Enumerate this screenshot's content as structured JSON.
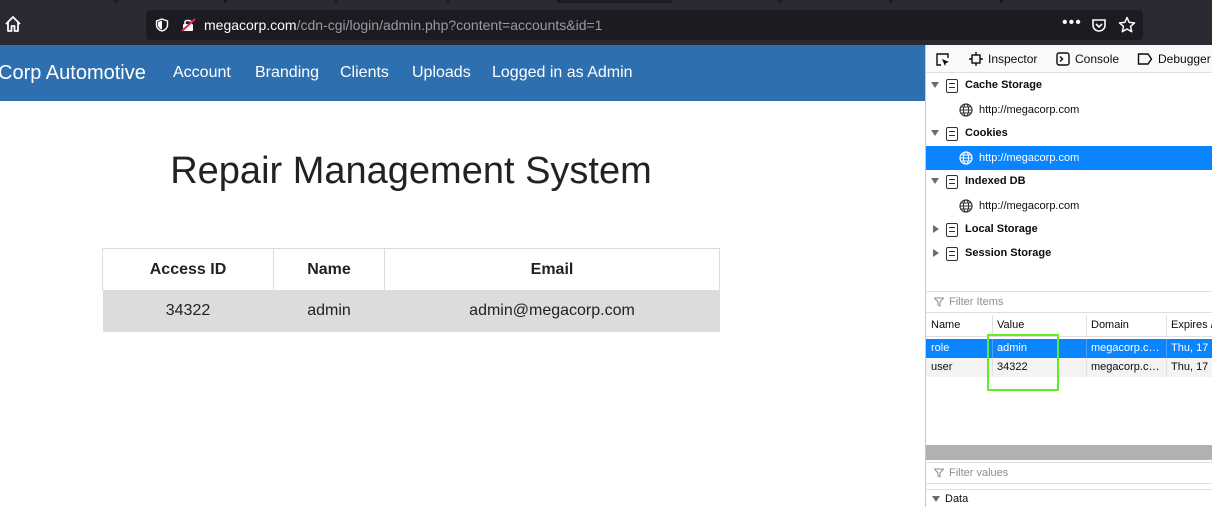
{
  "browser": {
    "url_host": "megacorp.com",
    "url_path": "/cdn-cgi/login/admin.php?content=accounts&id=1",
    "more_label": "•••",
    "icons": [
      "home-icon",
      "shield-icon",
      "insecure-lock-icon",
      "pocket-icon",
      "star-icon"
    ]
  },
  "site": {
    "brand": "Corp Automotive",
    "nav": [
      "Account",
      "Branding",
      "Clients",
      "Uploads",
      "Logged in as Admin"
    ],
    "title": "Repair Management System",
    "table": {
      "headers": [
        "Access ID",
        "Name",
        "Email"
      ],
      "rows": [
        [
          "34322",
          "admin",
          "admin@megacorp.com"
        ]
      ]
    },
    "colors": {
      "navbar": "#2e6fb0",
      "row_bg": "#dcdcdc"
    }
  },
  "devtools": {
    "tabs": [
      "Inspector",
      "Console",
      "Debugger"
    ],
    "tree": [
      {
        "label": "Cache Storage",
        "expanded": true,
        "children": [
          "http://megacorp.com"
        ]
      },
      {
        "label": "Cookies",
        "expanded": true,
        "children": [
          "http://megacorp.com"
        ]
      },
      {
        "label": "Indexed DB",
        "expanded": true,
        "children": [
          "http://megacorp.com"
        ]
      },
      {
        "label": "Local Storage",
        "expanded": false,
        "children": []
      },
      {
        "label": "Session Storage",
        "expanded": false,
        "children": []
      }
    ],
    "filter_items_placeholder": "Filter Items",
    "columns": [
      "Name",
      "Value",
      "Domain",
      "Expires /"
    ],
    "cookies": [
      {
        "name": "role",
        "value": "admin",
        "domain": "megacorp.c…",
        "expires": "Thu, 17 …"
      },
      {
        "name": "user",
        "value": "34322",
        "domain": "megacorp.c…",
        "expires": "Thu, 17 …"
      }
    ],
    "filter_values_placeholder": "Filter values",
    "data_label": "Data",
    "colors": {
      "selection": "#0a84ff",
      "highlight_box": "#5ef01a"
    }
  }
}
